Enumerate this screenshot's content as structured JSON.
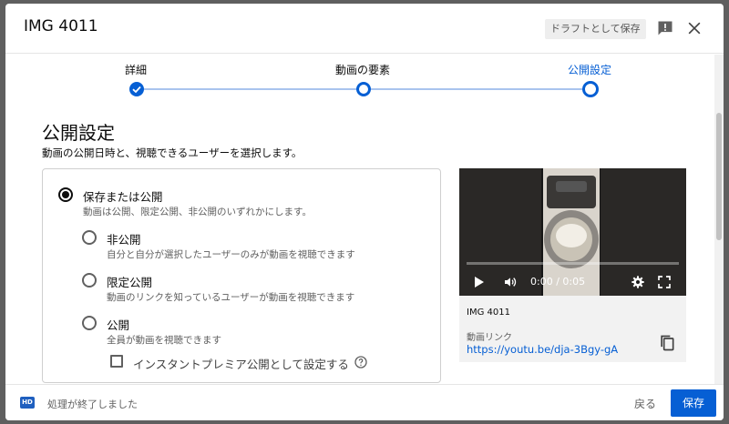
{
  "header": {
    "title": "IMG 4011",
    "draft_button": "ドラフトとして保存",
    "feedback_icon": "feedback-icon",
    "close_icon": "close-icon"
  },
  "steps": [
    {
      "label": "詳細",
      "state": "done"
    },
    {
      "label": "動画の要素",
      "state": "todo"
    },
    {
      "label": "公開設定",
      "state": "active"
    }
  ],
  "visibility": {
    "title": "公開設定",
    "description": "動画の公開日時と、視聴できるユーザーを選択します。",
    "save_or_publish": {
      "label": "保存または公開",
      "description": "動画は公開、限定公開、非公開のいずれかにします。",
      "checked": true
    },
    "options": [
      {
        "label": "非公開",
        "description": "自分と自分が選択したユーザーのみが動画を視聴できます"
      },
      {
        "label": "限定公開",
        "description": "動画のリンクを知っているユーザーが動画を視聴できます"
      },
      {
        "label": "公開",
        "description": "全員が動画を視聴できます"
      }
    ],
    "premiere_checkbox": {
      "label": "インスタントプレミア公開として設定する",
      "checked": false
    }
  },
  "video_card": {
    "time": "0:00 / 0:05",
    "filename": "IMG 4011",
    "link_label": "動画リンク",
    "link": "https://youtu.be/dja-3Bgy-gA",
    "copy_icon": "copy-icon"
  },
  "footer": {
    "badge": "HD",
    "status": "処理が終了しました",
    "back_button": "戻る",
    "save_button": "保存"
  },
  "colors": {
    "accent": "#065fd4",
    "text": "#0d0d0d",
    "secondary_text": "#606060"
  }
}
